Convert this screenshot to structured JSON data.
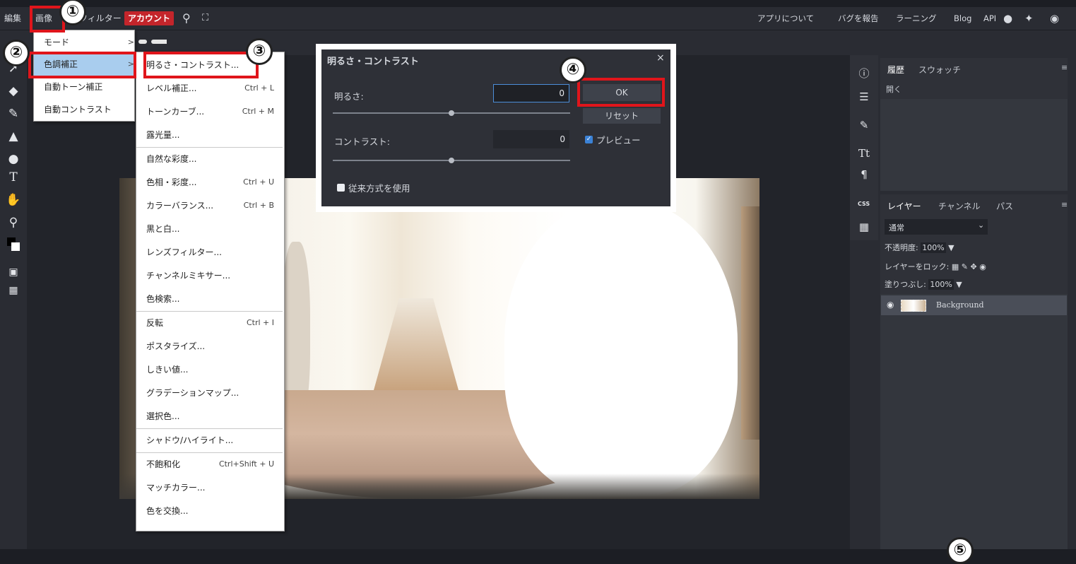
{
  "menubar": {
    "items": [
      "編集",
      "画像",
      "フィルター"
    ],
    "account": "アカウント",
    "right": [
      "アプリについて",
      "バグを報告",
      "ラーニング",
      "Blog",
      "API"
    ]
  },
  "image_menu": {
    "items": [
      "モード",
      "色調補正",
      "自動トーン補正",
      "自動コントラスト"
    ]
  },
  "adjust_menu": {
    "items": [
      {
        "label": "明るさ・コントラスト...",
        "shortcut": ""
      },
      {
        "label": "レベル補正...",
        "shortcut": "Ctrl + L"
      },
      {
        "label": "トーンカーブ...",
        "shortcut": "Ctrl + M"
      },
      {
        "label": "露光量...",
        "shortcut": ""
      },
      {
        "label": "自然な彩度...",
        "shortcut": ""
      },
      {
        "label": "色相・彩度...",
        "shortcut": "Ctrl + U"
      },
      {
        "label": "カラーバランス...",
        "shortcut": "Ctrl + B"
      },
      {
        "label": "黒と白...",
        "shortcut": ""
      },
      {
        "label": "レンズフィルター...",
        "shortcut": ""
      },
      {
        "label": "チャンネルミキサー...",
        "shortcut": ""
      },
      {
        "label": "色検索...",
        "shortcut": ""
      },
      {
        "label": "反転",
        "shortcut": "Ctrl + I"
      },
      {
        "label": "ポスタライズ...",
        "shortcut": ""
      },
      {
        "label": "しきい値...",
        "shortcut": ""
      },
      {
        "label": "グラデーションマップ...",
        "shortcut": ""
      },
      {
        "label": "選択色...",
        "shortcut": ""
      },
      {
        "label": "シャドウ/ハイライト...",
        "shortcut": ""
      },
      {
        "label": "不飽和化",
        "shortcut": "Ctrl+Shift + U"
      },
      {
        "label": "マッチカラー...",
        "shortcut": ""
      },
      {
        "label": "色を交換...",
        "shortcut": ""
      }
    ]
  },
  "dialog": {
    "title": "明るさ・コントラスト",
    "close": "×",
    "brightness_label": "明るさ:",
    "brightness_value": "0",
    "contrast_label": "コントラスト:",
    "contrast_value": "0",
    "ok": "OK",
    "reset": "リセット",
    "preview": "プレビュー",
    "legacy": "従来方式を使用",
    "brightness_slider_fraction": 0.5,
    "contrast_slider_fraction": 0.5
  },
  "badges": [
    "①",
    "②",
    "③",
    "④",
    "⑤"
  ],
  "history_panel": {
    "tabs": [
      "履歴",
      "スウォッチ"
    ],
    "entry": "開く"
  },
  "layers_panel": {
    "tabs": [
      "レイヤー",
      "チャンネル",
      "パス"
    ],
    "blend_mode": "通常",
    "opacity_label": "不透明度:",
    "opacity_value": "100%",
    "lock_label": "レイヤーをロック:",
    "fill_label": "塗りつぶし:",
    "fill_value": "100%",
    "layer_name": "Background"
  },
  "side_labels": {
    "css": "CSS"
  }
}
